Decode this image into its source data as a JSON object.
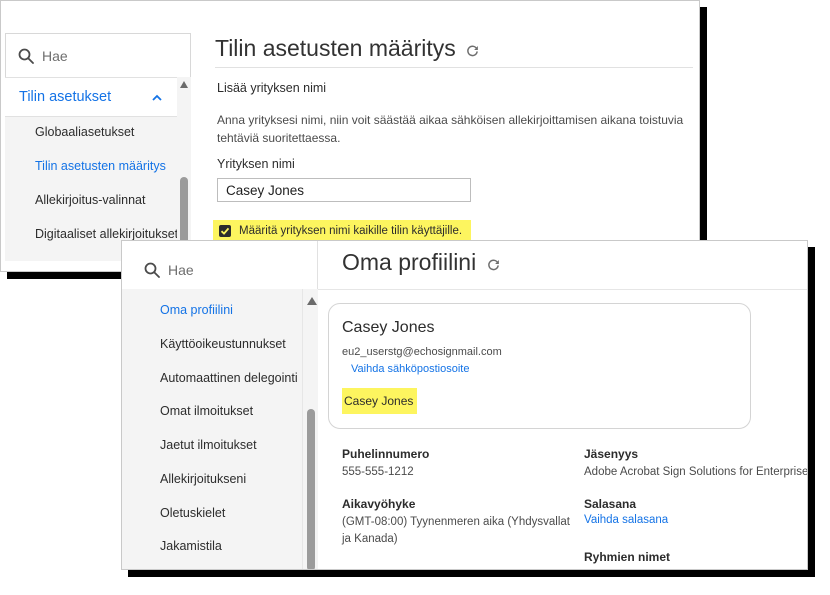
{
  "back": {
    "search_placeholder": "Hae",
    "section_label": "Tilin asetukset",
    "items": [
      {
        "label": "Globaaliasetukset"
      },
      {
        "label": "Tilin asetusten määritys"
      },
      {
        "label": "Allekirjoitus-valinnat"
      },
      {
        "label": "Digitaaliset allekirjoitukset"
      }
    ],
    "active_item": "Tilin asetusten määritys",
    "title": "Tilin asetusten määritys",
    "subheading": "Lisää yrityksen nimi",
    "description": "Anna yrityksesi nimi, niin voit säästää aikaa sähköisen allekirjoittamisen aikana toistuvia tehtäviä suoritettaessa.",
    "field_label": "Yrityksen nimi",
    "field_value": "Casey Jones",
    "checkbox_label": "Määritä yrityksen nimi kaikille tilin käyttäjille.",
    "checkbox_checked": true
  },
  "front": {
    "search_placeholder": "Hae",
    "items": [
      {
        "label": "Oma profiilini"
      },
      {
        "label": "Käyttöoikeustunnukset"
      },
      {
        "label": "Automaattinen delegointi"
      },
      {
        "label": "Omat ilmoitukset"
      },
      {
        "label": "Jaetut ilmoitukset"
      },
      {
        "label": "Allekirjoitukseni"
      },
      {
        "label": "Oletuskielet"
      },
      {
        "label": "Jakamistila"
      }
    ],
    "active_item": "Oma profiilini",
    "title": "Oma profiilini",
    "card": {
      "name": "Casey Jones",
      "email": "eu2_userstg@echosignmail.com",
      "change_email_link": "Vaihda sähköpostiosoite",
      "company": "Casey Jones"
    },
    "phone_label": "Puhelinnumero",
    "phone_value": "555-555-1212",
    "timezone_label": "Aikavyöhyke",
    "timezone_value": "(GMT-08:00) Tyynenmeren aika (Yhdysvallat ja Kanada)",
    "membership_label": "Jäsenyys",
    "membership_value": "Adobe Acrobat Sign Solutions for Enterprise",
    "password_label": "Salasana",
    "password_link": "Vaihda salasana",
    "group_names_label": "Ryhmien nimet"
  },
  "colors": {
    "accent": "#1473e6",
    "highlight": "#fdf55f",
    "sidebar_bg": "#f4f4f4"
  },
  "icons": [
    "search-icon",
    "chevron-up-icon",
    "refresh-icon",
    "checkmark-icon",
    "scroll-up-arrow-icon"
  ]
}
